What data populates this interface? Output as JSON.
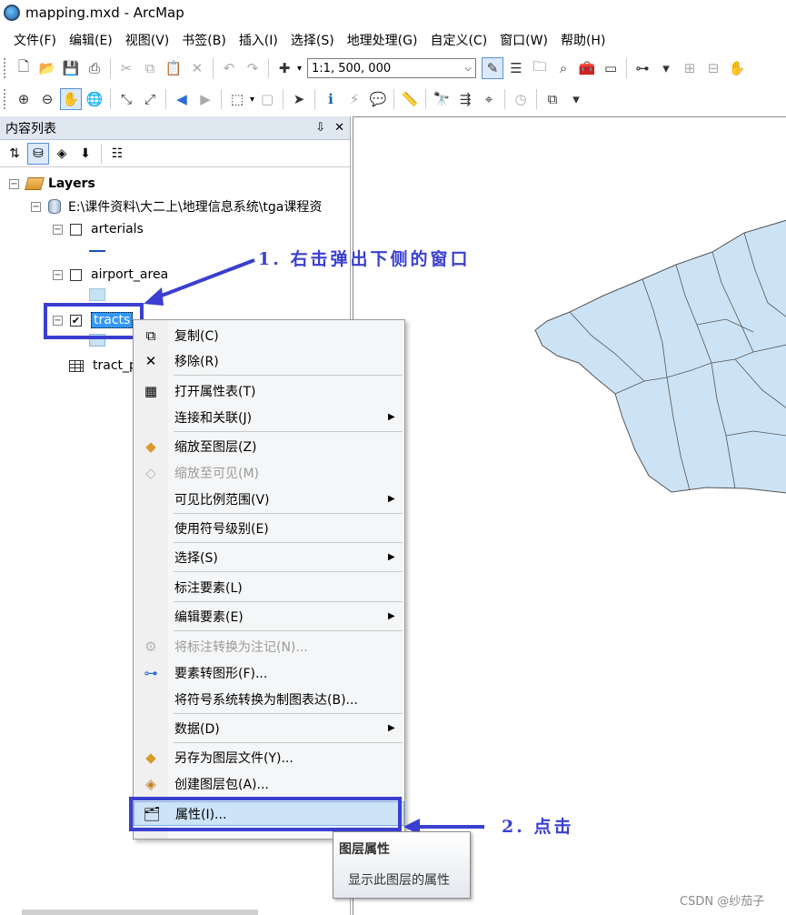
{
  "window": {
    "title": "mapping.mxd - ArcMap"
  },
  "menu": [
    "文件(F)",
    "编辑(E)",
    "视图(V)",
    "书签(B)",
    "插入(I)",
    "选择(S)",
    "地理处理(G)",
    "自定义(C)",
    "窗口(W)",
    "帮助(H)"
  ],
  "toolbar": {
    "scale_value": "1:1, 500, 000"
  },
  "toc": {
    "title": "内容列表",
    "pin_label": "⇩",
    "close_label": "✕",
    "root_label": "Layers",
    "datasource_label": "E:\\课件资料\\大二上\\地理信息系统\\tga课程资",
    "layers": [
      {
        "name": "arterials",
        "checked": false
      },
      {
        "name": "airport_area",
        "checked": false
      },
      {
        "name": "tracts",
        "checked": true,
        "selected": true
      }
    ],
    "table_label": "tract_p"
  },
  "context_menu": {
    "items": [
      {
        "label": "复制(C)",
        "icon": "copy-icon",
        "enabled": true
      },
      {
        "label": "移除(R)",
        "icon": "remove-icon",
        "enabled": true
      },
      {
        "label": "打开属性表(T)",
        "icon": "table-icon",
        "enabled": true
      },
      {
        "label": "连接和关联(J)",
        "icon": "",
        "enabled": true,
        "submenu": true
      },
      {
        "label": "缩放至图层(Z)",
        "icon": "zoom-layer-icon",
        "enabled": true
      },
      {
        "label": "缩放至可见(M)",
        "icon": "zoom-visible-icon",
        "enabled": false
      },
      {
        "label": "可见比例范围(V)",
        "icon": "",
        "enabled": true,
        "submenu": true
      },
      {
        "label": "使用符号级别(E)",
        "icon": "",
        "enabled": true
      },
      {
        "label": "选择(S)",
        "icon": "",
        "enabled": true,
        "submenu": true
      },
      {
        "label": "标注要素(L)",
        "icon": "",
        "enabled": true
      },
      {
        "label": "编辑要素(E)",
        "icon": "",
        "enabled": true,
        "submenu": true
      },
      {
        "label": "将标注转换为注记(N)...",
        "icon": "convert-labels-icon",
        "enabled": false
      },
      {
        "label": "要素转图形(F)...",
        "icon": "features-to-graphics-icon",
        "enabled": true
      },
      {
        "label": "将符号系统转换为制图表达(B)...",
        "icon": "",
        "enabled": true
      },
      {
        "label": "数据(D)",
        "icon": "",
        "enabled": true,
        "submenu": true
      },
      {
        "label": "另存为图层文件(Y)...",
        "icon": "save-layer-icon",
        "enabled": true
      },
      {
        "label": "创建图层包(A)...",
        "icon": "layer-package-icon",
        "enabled": true
      },
      {
        "label": "属性(I)...",
        "icon": "properties-icon",
        "enabled": true,
        "highlighted": true
      }
    ]
  },
  "tooltip": {
    "title": "图层属性",
    "description": "显示此图层的属性"
  },
  "annotations": {
    "step1": "1. 右击弹出下侧的窗口",
    "step2": "2. 点击"
  },
  "watermark": "CSDN @纱茄子",
  "colors": {
    "map_fill": "#cce3f5",
    "annotation": "#3a3fd0",
    "selection": "#3399ff"
  }
}
